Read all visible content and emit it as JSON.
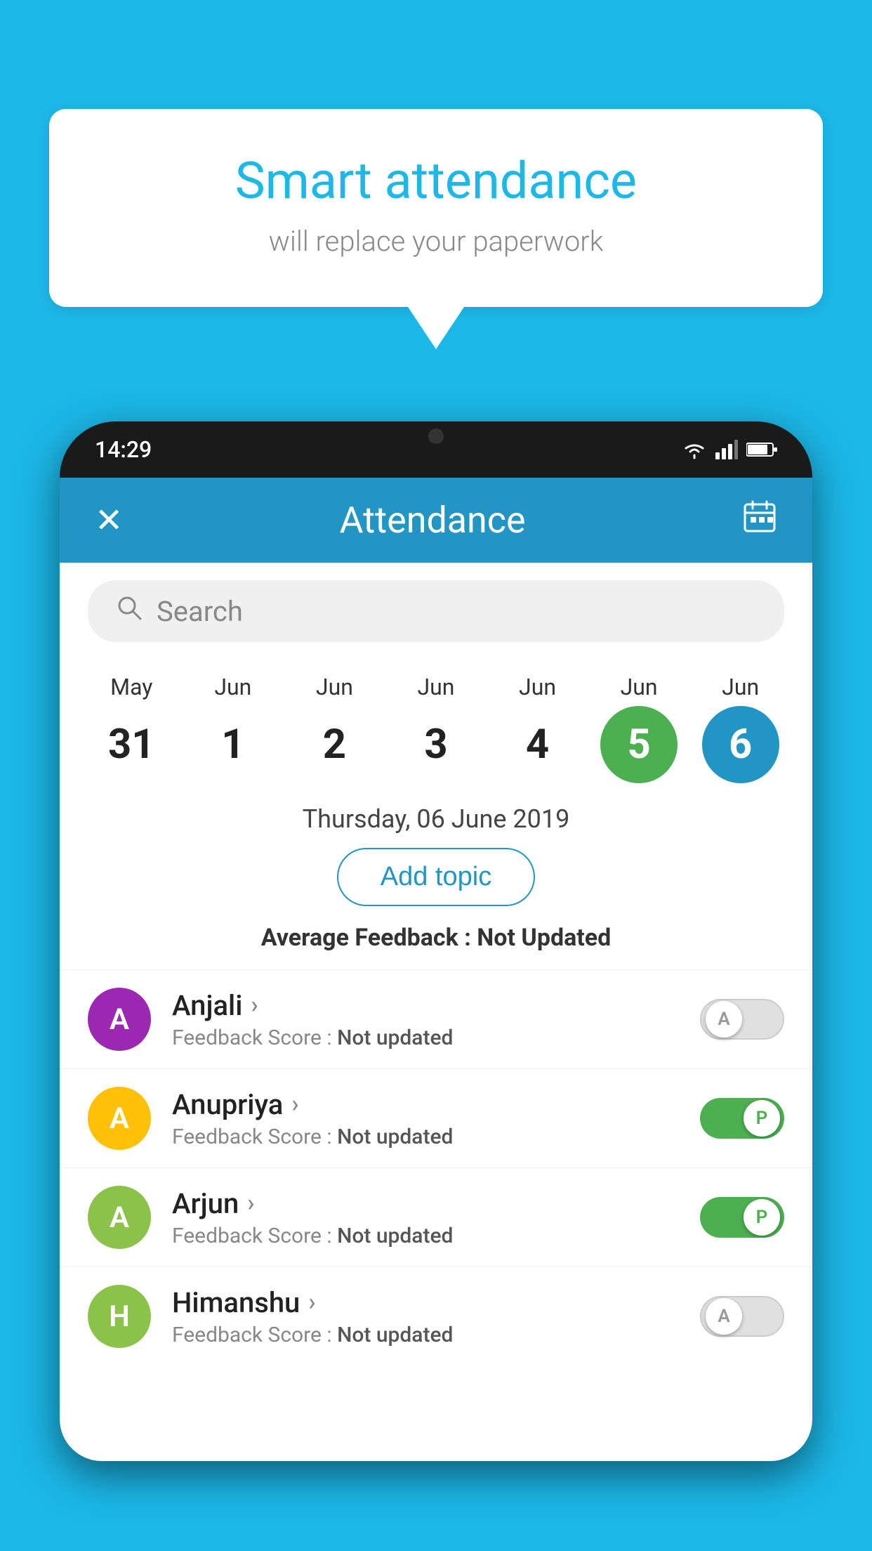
{
  "background": {
    "color": "#1BB8E8"
  },
  "speech_bubble": {
    "title": "Smart attendance",
    "subtitle": "will replace your paperwork",
    "tail_visible": true
  },
  "phone": {
    "status_bar": {
      "time": "14:29"
    },
    "header": {
      "close_label": "✕",
      "title": "Attendance",
      "calendar_icon": "📅"
    },
    "search": {
      "placeholder": "Search"
    },
    "dates": [
      {
        "month": "May",
        "day": "31",
        "highlight": null
      },
      {
        "month": "Jun",
        "day": "1",
        "highlight": null
      },
      {
        "month": "Jun",
        "day": "2",
        "highlight": null
      },
      {
        "month": "Jun",
        "day": "3",
        "highlight": null
      },
      {
        "month": "Jun",
        "day": "4",
        "highlight": null
      },
      {
        "month": "Jun",
        "day": "5",
        "highlight": "green"
      },
      {
        "month": "Jun",
        "day": "6",
        "highlight": "blue"
      }
    ],
    "selected_date": "Thursday, 06 June 2019",
    "add_topic_label": "Add topic",
    "feedback_summary": {
      "label": "Average Feedback : ",
      "value": "Not Updated"
    },
    "students": [
      {
        "name": "Anjali",
        "initials": "A",
        "avatar_color": "#9C27B0",
        "feedback_label": "Feedback Score : ",
        "feedback_value": "Not updated",
        "toggle": "off",
        "toggle_letter": "A"
      },
      {
        "name": "Anupriya",
        "initials": "A",
        "avatar_color": "#FFC107",
        "feedback_label": "Feedback Score : ",
        "feedback_value": "Not updated",
        "toggle": "on",
        "toggle_letter": "P"
      },
      {
        "name": "Arjun",
        "initials": "A",
        "avatar_color": "#8BC34A",
        "feedback_label": "Feedback Score : ",
        "feedback_value": "Not updated",
        "toggle": "on",
        "toggle_letter": "P"
      },
      {
        "name": "Himanshu",
        "initials": "H",
        "avatar_color": "#8BC34A",
        "feedback_label": "Feedback Score : ",
        "feedback_value": "Not updated",
        "toggle": "off",
        "toggle_letter": "A"
      }
    ]
  }
}
